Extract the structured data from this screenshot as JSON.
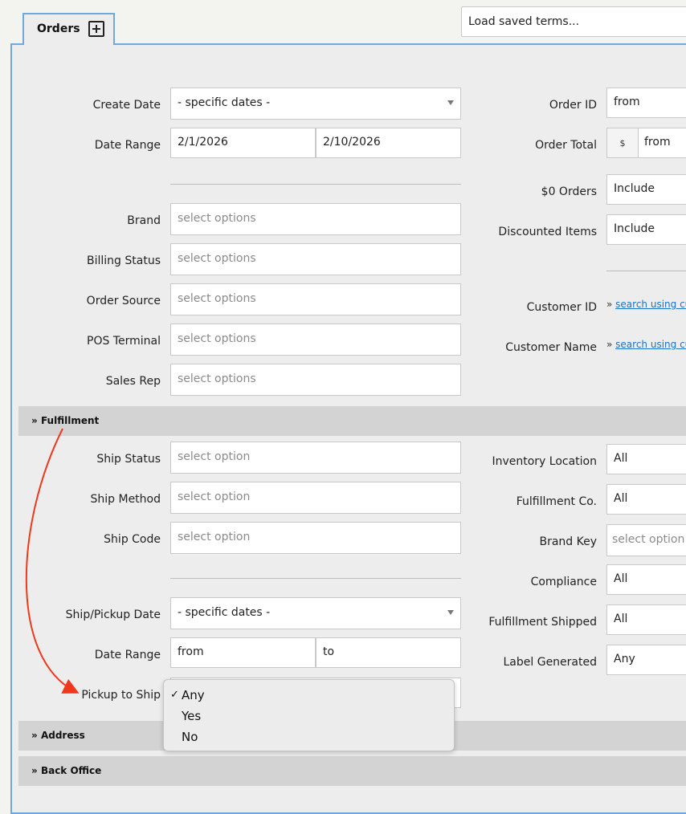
{
  "tab": {
    "label": "Orders"
  },
  "saved_terms": {
    "placeholder": "Load saved terms..."
  },
  "left": {
    "create_date": {
      "label": "Create Date",
      "value": "- specific dates -"
    },
    "date_range": {
      "label": "Date Range",
      "from": "2/1/2026",
      "to": "2/10/2026"
    },
    "brand": {
      "label": "Brand",
      "placeholder": "select options"
    },
    "billing_status": {
      "label": "Billing Status",
      "placeholder": "select options"
    },
    "order_source": {
      "label": "Order Source",
      "placeholder": "select options"
    },
    "pos_terminal": {
      "label": "POS Terminal",
      "placeholder": "select options"
    },
    "sales_rep": {
      "label": "Sales Rep",
      "placeholder": "select options"
    }
  },
  "right": {
    "order_id": {
      "label": "Order ID",
      "value": "from"
    },
    "order_total": {
      "label": "Order Total",
      "currency": "$",
      "value": "from"
    },
    "zero_orders": {
      "label": "$0 Orders",
      "value": "Include"
    },
    "discounted_items": {
      "label": "Discounted Items",
      "value": "Include"
    },
    "customer_id": {
      "label": "Customer ID",
      "link": "search using cu"
    },
    "customer_name": {
      "label": "Customer Name",
      "link": "search using cu"
    }
  },
  "fulfillment": {
    "title": "Fulfillment",
    "ship_status": {
      "label": "Ship Status",
      "placeholder": "select option"
    },
    "ship_method": {
      "label": "Ship Method",
      "placeholder": "select option"
    },
    "ship_code": {
      "label": "Ship Code",
      "placeholder": "select option"
    },
    "ship_pickup_date": {
      "label": "Ship/Pickup Date",
      "value": "- specific dates -"
    },
    "date_range": {
      "label": "Date Range",
      "from": "from",
      "to": "to"
    },
    "pickup_to_ship": {
      "label": "Pickup to Ship"
    },
    "inventory_location": {
      "label": "Inventory Location",
      "value": "All"
    },
    "fulfillment_co": {
      "label": "Fulfillment Co.",
      "value": "All"
    },
    "brand_key": {
      "label": "Brand Key",
      "placeholder": "select option"
    },
    "compliance": {
      "label": "Compliance",
      "value": "All"
    },
    "fulfillment_shipped": {
      "label": "Fulfillment Shipped",
      "value": "All"
    },
    "label_generated": {
      "label": "Label Generated",
      "value": "Any"
    }
  },
  "dropdown": {
    "options": [
      "Any",
      "Yes",
      "No"
    ],
    "selected": "Any",
    "check": "✓"
  },
  "sections": {
    "address": "Address",
    "back_office": "Back Office"
  },
  "link_arrow": "»",
  "colors": {
    "panel_border": "#6fa8dc",
    "annotation_arrow": "#f0391c",
    "link": "#1a73c9",
    "section_bar": "#d3d3d3"
  }
}
